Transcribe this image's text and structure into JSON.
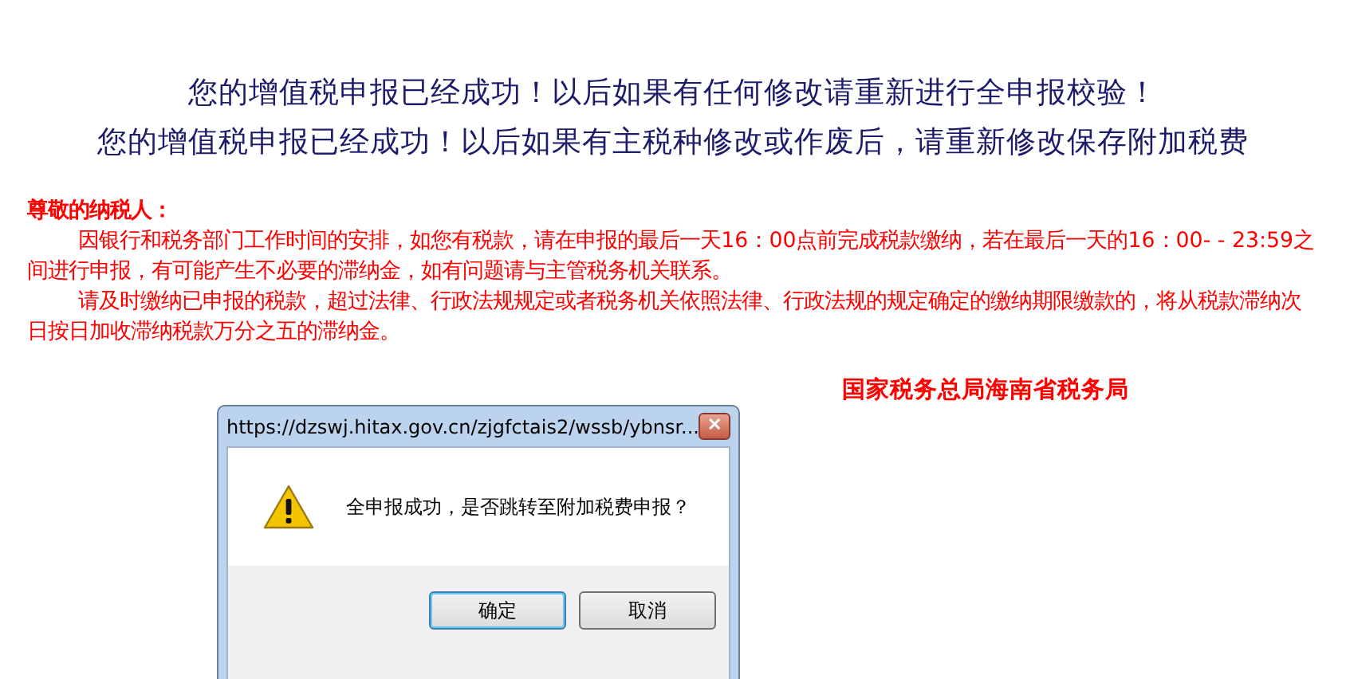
{
  "headings": [
    "您的增值税申报已经成功！以后如果有任何修改请重新进行全申报校验！",
    "您的增值税申报已经成功！以后如果有主税种修改或作废后，请重新修改保存附加税费"
  ],
  "notice": {
    "title": "尊敬的纳税人：",
    "paragraphs": [
      "因银行和税务部门工作时间的安排，如您有税款，请在申报的最后一天16：00点前完成税款缴纳，若在最后一天的16：00- - 23:59之间进行申报，有可能产生不必要的滞纳金，如有问题请与主管税务机关联系。",
      "请及时缴纳已申报的税款，超过法律、行政法规规定或者税务机关依照法律、行政法规的规定确定的缴纳期限缴款的，将从税款滞纳次日按日加收滞纳税款万分之五的滞纳金。"
    ],
    "signature": "国家税务总局海南省税务局"
  },
  "dialog": {
    "title": "https://dzswj.hitax.gov.cn/zjgfctais2/wssb/ybnsr...",
    "close": "✕",
    "message": "全申报成功，是否跳转至附加税费申报？",
    "buttons": [
      {
        "label": "确定",
        "selected": true
      },
      {
        "label": "取消",
        "selected": false
      }
    ]
  }
}
